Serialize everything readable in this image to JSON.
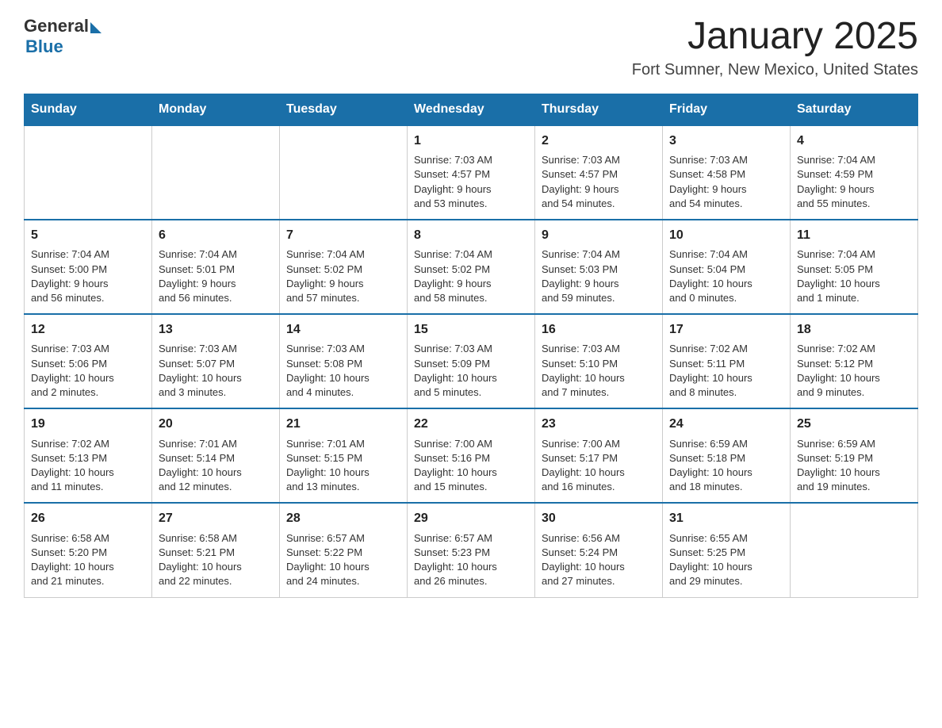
{
  "header": {
    "logo_general": "General",
    "logo_blue": "Blue",
    "month": "January 2025",
    "location": "Fort Sumner, New Mexico, United States"
  },
  "days_of_week": [
    "Sunday",
    "Monday",
    "Tuesday",
    "Wednesday",
    "Thursday",
    "Friday",
    "Saturday"
  ],
  "weeks": [
    [
      {
        "day": "",
        "info": ""
      },
      {
        "day": "",
        "info": ""
      },
      {
        "day": "",
        "info": ""
      },
      {
        "day": "1",
        "info": "Sunrise: 7:03 AM\nSunset: 4:57 PM\nDaylight: 9 hours\nand 53 minutes."
      },
      {
        "day": "2",
        "info": "Sunrise: 7:03 AM\nSunset: 4:57 PM\nDaylight: 9 hours\nand 54 minutes."
      },
      {
        "day": "3",
        "info": "Sunrise: 7:03 AM\nSunset: 4:58 PM\nDaylight: 9 hours\nand 54 minutes."
      },
      {
        "day": "4",
        "info": "Sunrise: 7:04 AM\nSunset: 4:59 PM\nDaylight: 9 hours\nand 55 minutes."
      }
    ],
    [
      {
        "day": "5",
        "info": "Sunrise: 7:04 AM\nSunset: 5:00 PM\nDaylight: 9 hours\nand 56 minutes."
      },
      {
        "day": "6",
        "info": "Sunrise: 7:04 AM\nSunset: 5:01 PM\nDaylight: 9 hours\nand 56 minutes."
      },
      {
        "day": "7",
        "info": "Sunrise: 7:04 AM\nSunset: 5:02 PM\nDaylight: 9 hours\nand 57 minutes."
      },
      {
        "day": "8",
        "info": "Sunrise: 7:04 AM\nSunset: 5:02 PM\nDaylight: 9 hours\nand 58 minutes."
      },
      {
        "day": "9",
        "info": "Sunrise: 7:04 AM\nSunset: 5:03 PM\nDaylight: 9 hours\nand 59 minutes."
      },
      {
        "day": "10",
        "info": "Sunrise: 7:04 AM\nSunset: 5:04 PM\nDaylight: 10 hours\nand 0 minutes."
      },
      {
        "day": "11",
        "info": "Sunrise: 7:04 AM\nSunset: 5:05 PM\nDaylight: 10 hours\nand 1 minute."
      }
    ],
    [
      {
        "day": "12",
        "info": "Sunrise: 7:03 AM\nSunset: 5:06 PM\nDaylight: 10 hours\nand 2 minutes."
      },
      {
        "day": "13",
        "info": "Sunrise: 7:03 AM\nSunset: 5:07 PM\nDaylight: 10 hours\nand 3 minutes."
      },
      {
        "day": "14",
        "info": "Sunrise: 7:03 AM\nSunset: 5:08 PM\nDaylight: 10 hours\nand 4 minutes."
      },
      {
        "day": "15",
        "info": "Sunrise: 7:03 AM\nSunset: 5:09 PM\nDaylight: 10 hours\nand 5 minutes."
      },
      {
        "day": "16",
        "info": "Sunrise: 7:03 AM\nSunset: 5:10 PM\nDaylight: 10 hours\nand 7 minutes."
      },
      {
        "day": "17",
        "info": "Sunrise: 7:02 AM\nSunset: 5:11 PM\nDaylight: 10 hours\nand 8 minutes."
      },
      {
        "day": "18",
        "info": "Sunrise: 7:02 AM\nSunset: 5:12 PM\nDaylight: 10 hours\nand 9 minutes."
      }
    ],
    [
      {
        "day": "19",
        "info": "Sunrise: 7:02 AM\nSunset: 5:13 PM\nDaylight: 10 hours\nand 11 minutes."
      },
      {
        "day": "20",
        "info": "Sunrise: 7:01 AM\nSunset: 5:14 PM\nDaylight: 10 hours\nand 12 minutes."
      },
      {
        "day": "21",
        "info": "Sunrise: 7:01 AM\nSunset: 5:15 PM\nDaylight: 10 hours\nand 13 minutes."
      },
      {
        "day": "22",
        "info": "Sunrise: 7:00 AM\nSunset: 5:16 PM\nDaylight: 10 hours\nand 15 minutes."
      },
      {
        "day": "23",
        "info": "Sunrise: 7:00 AM\nSunset: 5:17 PM\nDaylight: 10 hours\nand 16 minutes."
      },
      {
        "day": "24",
        "info": "Sunrise: 6:59 AM\nSunset: 5:18 PM\nDaylight: 10 hours\nand 18 minutes."
      },
      {
        "day": "25",
        "info": "Sunrise: 6:59 AM\nSunset: 5:19 PM\nDaylight: 10 hours\nand 19 minutes."
      }
    ],
    [
      {
        "day": "26",
        "info": "Sunrise: 6:58 AM\nSunset: 5:20 PM\nDaylight: 10 hours\nand 21 minutes."
      },
      {
        "day": "27",
        "info": "Sunrise: 6:58 AM\nSunset: 5:21 PM\nDaylight: 10 hours\nand 22 minutes."
      },
      {
        "day": "28",
        "info": "Sunrise: 6:57 AM\nSunset: 5:22 PM\nDaylight: 10 hours\nand 24 minutes."
      },
      {
        "day": "29",
        "info": "Sunrise: 6:57 AM\nSunset: 5:23 PM\nDaylight: 10 hours\nand 26 minutes."
      },
      {
        "day": "30",
        "info": "Sunrise: 6:56 AM\nSunset: 5:24 PM\nDaylight: 10 hours\nand 27 minutes."
      },
      {
        "day": "31",
        "info": "Sunrise: 6:55 AM\nSunset: 5:25 PM\nDaylight: 10 hours\nand 29 minutes."
      },
      {
        "day": "",
        "info": ""
      }
    ]
  ]
}
